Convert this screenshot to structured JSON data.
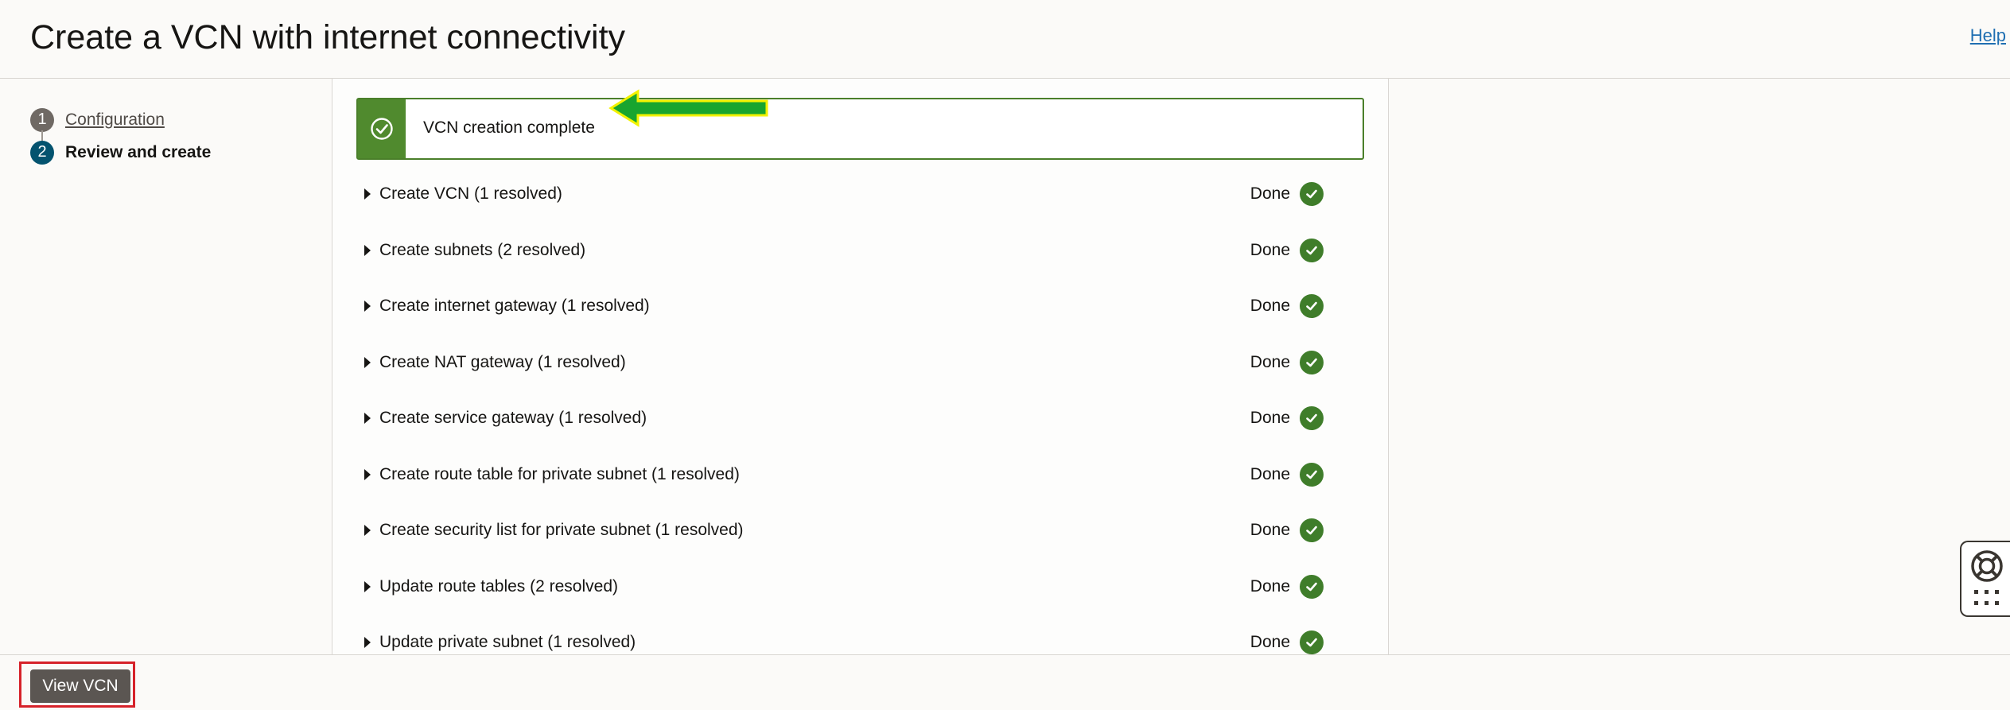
{
  "header": {
    "title": "Create a VCN with internet connectivity",
    "help_label": "Help"
  },
  "steps": [
    {
      "number": "1",
      "label": "Configuration",
      "state": "done"
    },
    {
      "number": "2",
      "label": "Review and create",
      "state": "current"
    }
  ],
  "banner": {
    "message": "VCN creation complete",
    "icon": "check-circle-icon",
    "color": "#508a2e"
  },
  "annotation_arrow": {
    "icon": "arrow-left-icon",
    "color": "#18a52f",
    "outline": "#f2f200"
  },
  "tasks": [
    {
      "label": "Create VCN (1 resolved)",
      "status": "Done"
    },
    {
      "label": "Create subnets (2 resolved)",
      "status": "Done"
    },
    {
      "label": "Create internet gateway (1 resolved)",
      "status": "Done"
    },
    {
      "label": "Create NAT gateway (1 resolved)",
      "status": "Done"
    },
    {
      "label": "Create service gateway (1 resolved)",
      "status": "Done"
    },
    {
      "label": "Create route table for private subnet (1 resolved)",
      "status": "Done"
    },
    {
      "label": "Create security list for private subnet (1 resolved)",
      "status": "Done"
    },
    {
      "label": "Update route tables (2 resolved)",
      "status": "Done"
    },
    {
      "label": "Update private subnet (1 resolved)",
      "status": "Done"
    }
  ],
  "footer": {
    "view_vcn_label": "View VCN",
    "highlight_color": "#d6222a"
  },
  "widget": {
    "icons": [
      "lifebuoy-icon",
      "grid-icon"
    ]
  }
}
